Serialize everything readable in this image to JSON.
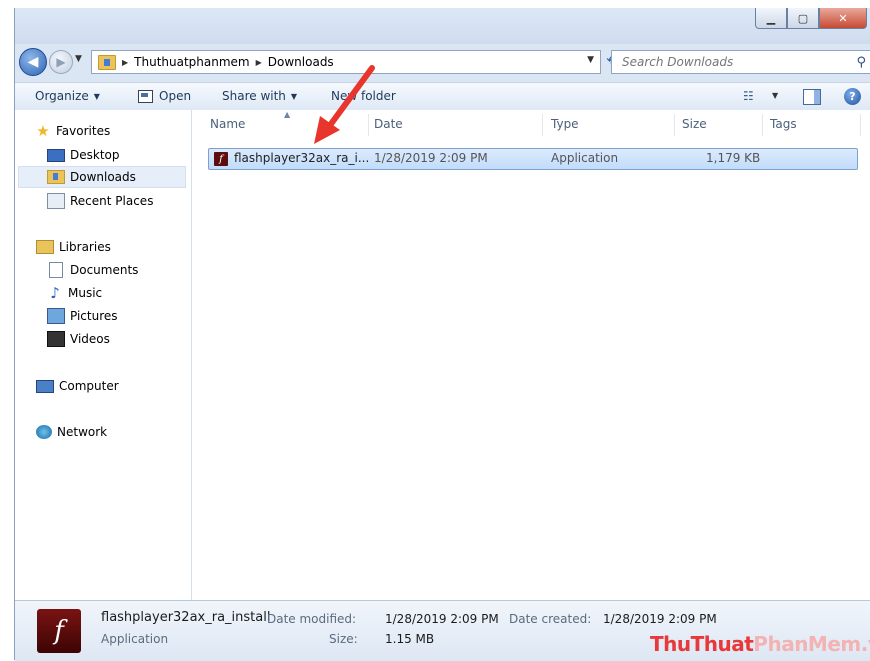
{
  "window": {
    "minimize": "▁",
    "maximize": "▢",
    "close": "✕"
  },
  "nav": {
    "back_icon": "arrow-left-icon",
    "forward_icon": "arrow-right-icon",
    "breadcrumb": [
      "Thuthuatphanmem",
      "Downloads"
    ],
    "search_placeholder": "Search Downloads"
  },
  "toolbar": {
    "organize": "Organize",
    "open": "Open",
    "share_with": "Share with",
    "new_folder": "New folder"
  },
  "sidebar": {
    "favorites": {
      "label": "Favorites",
      "items": [
        {
          "label": "Desktop"
        },
        {
          "label": "Downloads",
          "selected": true
        },
        {
          "label": "Recent Places"
        }
      ]
    },
    "libraries": {
      "label": "Libraries",
      "items": [
        {
          "label": "Documents"
        },
        {
          "label": "Music"
        },
        {
          "label": "Pictures"
        },
        {
          "label": "Videos"
        }
      ]
    },
    "computer": "Computer",
    "network": "Network"
  },
  "columns": [
    "Name",
    "Date",
    "Type",
    "Size",
    "Tags"
  ],
  "files": [
    {
      "name": "flashplayer32ax_ra_i...",
      "date": "1/28/2019 2:09 PM",
      "type": "Application",
      "size": "1,179 KB",
      "icon": "flash-installer-icon"
    }
  ],
  "details": {
    "filename": "flashplayer32ax_ra_install",
    "kind": "Application",
    "date_modified_label": "Date modified:",
    "date_modified": "1/28/2019 2:09 PM",
    "size_label": "Size:",
    "size": "1.15 MB",
    "date_created_label": "Date created:",
    "date_created": "1/28/2019 2:09 PM"
  },
  "annotation": {
    "arrow_color": "#e8362c"
  },
  "watermark": {
    "part1": "ThuThuat",
    "part2": "PhanMem.vn"
  },
  "colors": {
    "selection": "#c1dcfc",
    "chrome": "#dbe6f4",
    "link_text": "#1e395b"
  }
}
